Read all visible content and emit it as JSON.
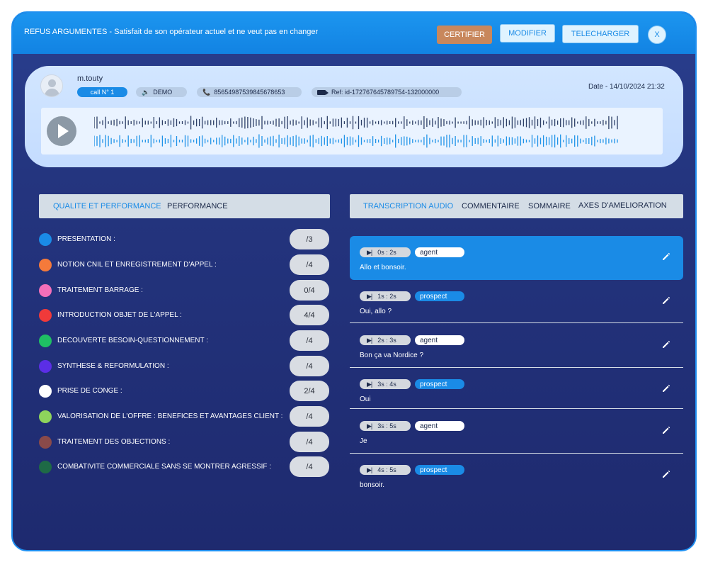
{
  "header": {
    "title": "REFUS ARGUMENTES - Satisfait de son opérateur actuel et ne veut pas en changer",
    "buttons": {
      "certifier": "CERTIFIER",
      "modifier": "MODIFIER",
      "telecharger": "TELECHARGER",
      "close": "X"
    },
    "colors": {
      "bar": "#1283e3",
      "certifier": "#c8875c"
    }
  },
  "call": {
    "username": "m.touty",
    "call_label": "call N° 1",
    "campaign": "DEMO",
    "phone": "85654987539845678653",
    "ref": "Ref: id-172767645789754-132000000",
    "date": "Date - 14/10/2024 21:32"
  },
  "player": {
    "icon": "play-icon"
  },
  "left_tabs": [
    {
      "label": "QUALITE ET PERFORMANCE",
      "active": true
    },
    {
      "label": "PERFORMANCE",
      "active": false
    }
  ],
  "criteria": [
    {
      "label": "PRESENTATION :",
      "score": "/3",
      "color": "#1a8be6"
    },
    {
      "label": "NOTION CNIL ET ENREGISTREMENT D'APPEL :",
      "score": "/4",
      "color": "#f47a3b"
    },
    {
      "label": "TRAITEMENT BARRAGE :",
      "score": "0/4",
      "color": "#f36fb9"
    },
    {
      "label": "INTRODUCTION OBJET DE L'APPEL :",
      "score": "4/4",
      "color": "#f03a3a"
    },
    {
      "label": "DECOUVERTE BESOIN-QUESTIONNEMENT :",
      "score": "/4",
      "color": "#1fbf64"
    },
    {
      "label": "SYNTHESE & REFORMULATION :",
      "score": "/4",
      "color": "#5b2ee6"
    },
    {
      "label": "PRISE DE CONGE :",
      "score": "2/4",
      "color": "#ffffff"
    },
    {
      "label": "VALORISATION DE L'OFFRE : BENEFICES ET AVANTAGES CLIENT :",
      "score": "/4",
      "color": "#8ed45c"
    },
    {
      "label": "TRAITEMENT DES OBJECTIONS :",
      "score": "/4",
      "color": "#8a4a4a"
    },
    {
      "label": "COMBATIVITE COMMERCIALE SANS SE MONTRER AGRESSIF :",
      "score": "/4",
      "color": "#1e6a46"
    }
  ],
  "right_tabs": [
    {
      "label": "TRANSCRIPTION AUDIO",
      "active": true
    },
    {
      "label": "COMMENTAIRE",
      "active": false
    },
    {
      "label": "SOMMAIRE",
      "active": false
    },
    {
      "label": "AXES D'AMELIORATION",
      "active": false
    }
  ],
  "transcript": [
    {
      "time": "0s : 2s",
      "role": "agent",
      "text": "Allo et bonsoir."
    },
    {
      "time": "1s : 2s",
      "role": "prospect",
      "text": "Oui, allo ?"
    },
    {
      "time": "2s : 3s",
      "role": "agent",
      "text": "Bon ça va Nordice ?"
    },
    {
      "time": "3s : 4s",
      "role": "prospect",
      "text": "Oui"
    },
    {
      "time": "3s : 5s",
      "role": "agent",
      "text": "Je"
    },
    {
      "time": "4s : 5s",
      "role": "prospect",
      "text": "bonsoir."
    }
  ]
}
